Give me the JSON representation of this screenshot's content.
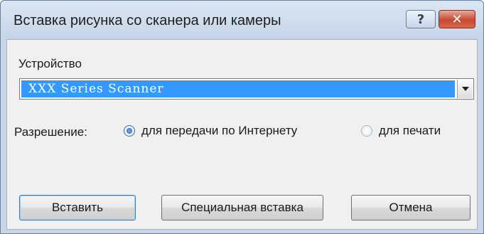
{
  "window": {
    "title": "Вставка рисунка со сканера или камеры",
    "help_glyph": "?",
    "close_glyph": "✕"
  },
  "device": {
    "label": "Устройство",
    "selected": "XXX Series Scanner"
  },
  "resolution": {
    "label": "Разрешение:",
    "options": [
      {
        "label": "для передачи по Интернету",
        "checked": true
      },
      {
        "label": "для печати",
        "checked": false
      }
    ]
  },
  "buttons": {
    "insert": "Вставить",
    "special_insert": "Специальная вставка",
    "cancel": "Отмена"
  },
  "colors": {
    "selection": "#3399ff",
    "close_button": "#c9482f",
    "titlebar": "#c5d5e9",
    "client_bg": "#f0f0f0"
  }
}
